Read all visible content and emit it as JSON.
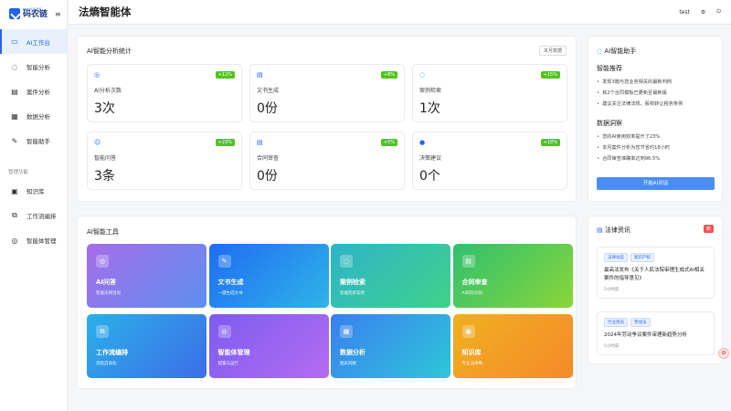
{
  "sidebar": {
    "logo_sub": "mayiCASES",
    "logo_name": "码农链",
    "collapse_icon": "≡",
    "items": [
      {
        "label": "AI工作台",
        "icon": "▭"
      },
      {
        "label": "智能分析",
        "icon": "◌"
      },
      {
        "label": "案件分析",
        "icon": "▤"
      },
      {
        "label": "数据分析",
        "icon": "▦"
      },
      {
        "label": "智能助手",
        "icon": "✎"
      }
    ],
    "section_label": "管理功能",
    "manage_items": [
      {
        "label": "知识库",
        "icon": "▣"
      },
      {
        "label": "工作流编排",
        "icon": "⧉"
      },
      {
        "label": "智能体管理",
        "icon": "◎"
      }
    ]
  },
  "header": {
    "title": "法熵智能体",
    "user": "test",
    "settings_icon": "⚙",
    "power_icon": "⏻"
  },
  "stats": {
    "title": "AI智能分析统计",
    "period_button": "本月数据",
    "cards": [
      {
        "icon": "◎",
        "label": "AI分析次数",
        "value": "3次",
        "badge": "+12%"
      },
      {
        "icon": "▤",
        "label": "文书生成",
        "value": "0份",
        "badge": "+8%"
      },
      {
        "icon": "◌",
        "label": "案例检索",
        "value": "1次",
        "badge": "+15%"
      },
      {
        "icon": "☺",
        "label": "智能问答",
        "value": "3条",
        "badge": "+23%"
      },
      {
        "icon": "▤",
        "label": "合同审查",
        "value": "0份",
        "badge": "+5%"
      },
      {
        "icon": "●",
        "label": "决策建议",
        "value": "0个",
        "badge": "+18%"
      }
    ]
  },
  "tools": {
    "title": "AI智能工具",
    "items": [
      {
        "name": "AI问答",
        "desc": "智能法律咨询",
        "icon": "◎",
        "color": "linear-gradient(135deg,#a66ee8,#5d8ff0)"
      },
      {
        "name": "文书生成",
        "desc": "一键生成文书",
        "icon": "✎",
        "color": "linear-gradient(135deg,#1f6df2,#2fb3e8)"
      },
      {
        "name": "案例检索",
        "desc": "智能检索案例",
        "icon": "◌",
        "color": "linear-gradient(135deg,#2fb3c8,#3fd28a)"
      },
      {
        "name": "合同审查",
        "desc": "AI风险识别",
        "icon": "▤",
        "color": "linear-gradient(135deg,#2fc070,#8ad63a)"
      },
      {
        "name": "工作流编排",
        "desc": "流程自动化",
        "icon": "⧉",
        "color": "linear-gradient(135deg,#2ab0e8,#3d6ee8)"
      },
      {
        "name": "智能体管理",
        "desc": "配置与运行",
        "icon": "◎",
        "color": "linear-gradient(135deg,#7c5cf0,#b46cf0)"
      },
      {
        "name": "数据分析",
        "desc": "图表洞察",
        "icon": "▦",
        "color": "linear-gradient(135deg,#3a7ef0,#2ec7d8)"
      },
      {
        "name": "知识库",
        "desc": "专业法律库",
        "icon": "▣",
        "color": "linear-gradient(135deg,#f0b020,#f58a2a)"
      }
    ]
  },
  "assistant": {
    "title": "AI智能助手",
    "title_icon": "◌",
    "section1": "智能推荐",
    "recommendations": [
      "发现3篇与您业务相关的最新判例",
      "有2个合同模板已更新至最新版",
      "建议关注法律法规、股权转让税务条例"
    ],
    "section2": "数据洞察",
    "insights": [
      "您的AI使用效率提升了23%",
      "本月案件分析为您节省约18小时",
      "合同审查准确率达到96.5%"
    ],
    "start_button": "开始AI对话"
  },
  "news": {
    "title": "法律资讯",
    "title_icon": "▤",
    "badge": "新",
    "items": [
      {
        "tags": [
          "法律动态",
          "知识产权"
        ],
        "title": "最高法发布《关于人民法院审理生成式AI相关案件的指导意见》",
        "time": "2小时前"
      },
      {
        "tags": [
          "行业资讯",
          "劳动法"
        ],
        "title": "2024年劳动争议案件审理新趋势分析",
        "time": "5小时前"
      }
    ]
  },
  "float_icon": "✿"
}
